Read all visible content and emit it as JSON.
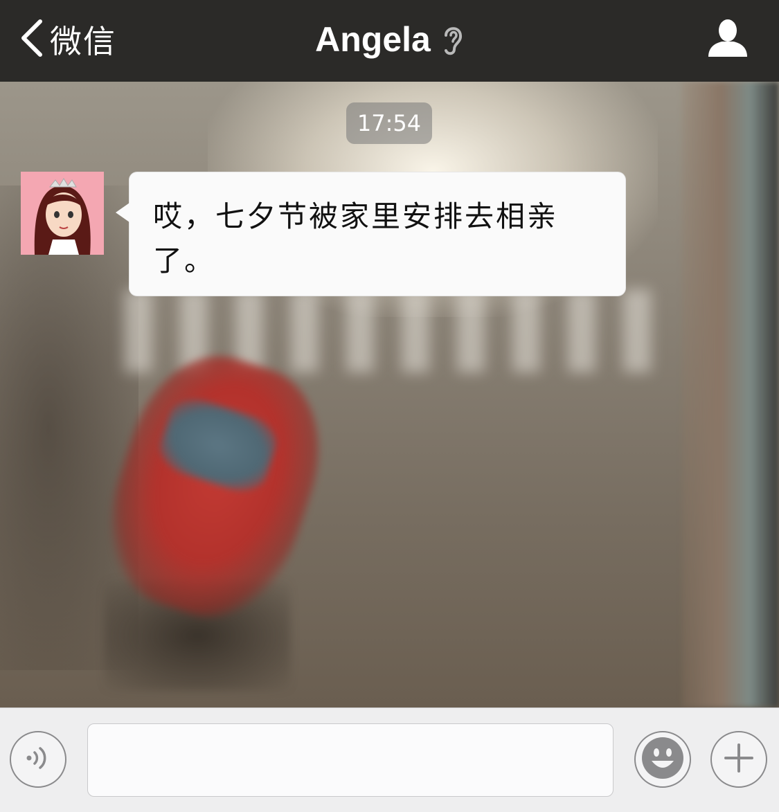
{
  "header": {
    "back_label": "微信",
    "title": "Angela",
    "icons": {
      "back": "chevron-left-icon",
      "mode": "ear-icon",
      "profile": "person-icon"
    }
  },
  "chat": {
    "timestamp": "17:54",
    "messages": [
      {
        "sender": "Angela",
        "avatar": "avatar-icon",
        "text": "哎，七夕节被家里安排去相亲了。"
      }
    ]
  },
  "input_bar": {
    "text_value": "",
    "icons": {
      "voice": "voice-icon",
      "emoji": "emoji-icon",
      "more": "plus-icon"
    }
  },
  "colors": {
    "header_bg": "#2b2a28",
    "bubble_bg": "#fafafa",
    "input_bar_bg": "#eeeeef",
    "avatar_bg": "#f4a7b2"
  }
}
